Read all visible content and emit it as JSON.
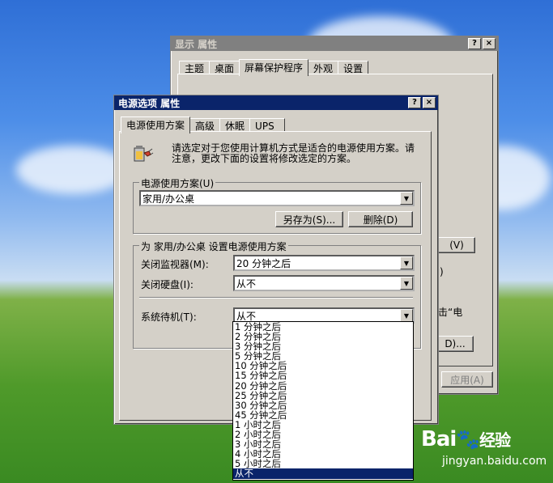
{
  "display_props": {
    "title": "显示 属性",
    "tabs": [
      "主题",
      "桌面",
      "屏幕保护程序",
      "外观",
      "设置"
    ],
    "partial_button_v": "(V)",
    "partial_paren": ")",
    "partial_text": "击“电",
    "partial_button_dots": "D)...",
    "apply_button": "应用(A)"
  },
  "power_options": {
    "title": "电源选项 属性",
    "title_buttons": [
      "?",
      "×"
    ],
    "tabs": [
      "电源使用方案",
      "高级",
      "休眠",
      "UPS"
    ],
    "description": "请选定对于您使用计算机方式是适合的电源使用方案。请注意，更改下面的设置将修改选定的方案。",
    "scheme_group_label": "电源使用方案(U)",
    "scheme_value": "家用/办公桌",
    "save_as_button": "另存为(S)...",
    "delete_button": "删除(D)",
    "settings_group_label": "为 家用/办公桌 设置电源使用方案",
    "monitor_label": "关闭监视器(M):",
    "monitor_value": "20 分钟之后",
    "hdd_label": "关闭硬盘(I):",
    "hdd_value": "从不",
    "standby_label": "系统待机(T):",
    "standby_value": "从不",
    "standby_options": [
      "1 分钟之后",
      "2 分钟之后",
      "3 分钟之后",
      "5 分钟之后",
      "10 分钟之后",
      "15 分钟之后",
      "20 分钟之后",
      "25 分钟之后",
      "30 分钟之后",
      "45 分钟之后",
      "1 小时之后",
      "2 小时之后",
      "3 小时之后",
      "4 小时之后",
      "5 小时之后",
      "从不"
    ],
    "selected_option": "从不"
  },
  "watermark": {
    "brand": "Bai",
    "brand_suffix": "经验",
    "url": "jingyan.baidu.com"
  }
}
